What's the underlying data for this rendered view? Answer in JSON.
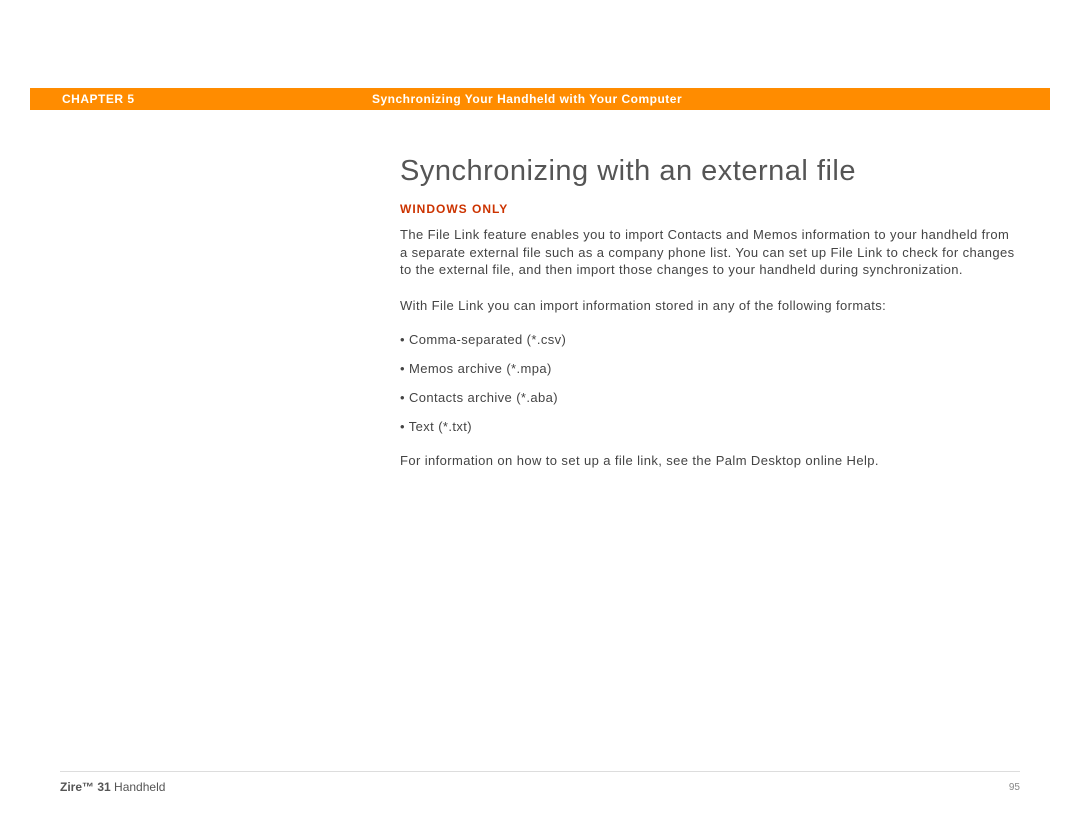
{
  "header": {
    "chapter_label": "CHAPTER 5",
    "chapter_title": "Synchronizing Your Handheld with Your Computer"
  },
  "main": {
    "heading": "Synchronizing with an external file",
    "platform_note": "WINDOWS ONLY",
    "paragraph1": "The File Link feature enables you to import Contacts and Memos information to your handheld from a separate external file such as a company phone list. You can set up File Link to check for changes to the external file, and then import those changes to your handheld during synchronization.",
    "paragraph2": "With File Link you can import information stored in any of the following formats:",
    "bullets": [
      "Comma-separated (*.csv)",
      "Memos archive (*.mpa)",
      "Contacts archive (*.aba)",
      "Text (*.txt)"
    ],
    "paragraph3": "For information on how to set up a file link, see the Palm Desktop online Help."
  },
  "footer": {
    "product_bold": "Zire™ 31",
    "product_rest": " Handheld",
    "page_number": "95"
  }
}
